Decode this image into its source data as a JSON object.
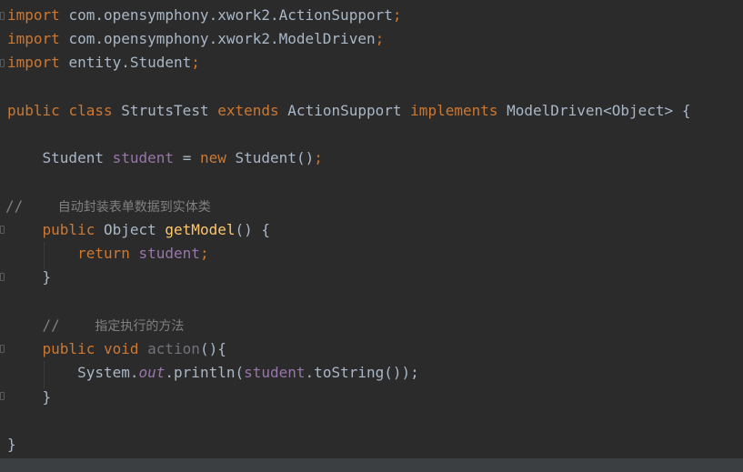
{
  "editor": {
    "line1": {
      "kw": "import",
      "path": "com.opensymphony.xwork2.ActionSupport",
      "semi": ";"
    },
    "line2": {
      "kw": "import",
      "path": "com.opensymphony.xwork2.ModelDriven",
      "semi": ";"
    },
    "line3": {
      "kw": "import",
      "path": "entity.Student",
      "semi": ";"
    },
    "classdecl": {
      "public": "public",
      "class": "class",
      "name": "StrutsTest",
      "extends": "extends",
      "parent": "ActionSupport",
      "implements": "implements",
      "iface": "ModelDriven<Object>",
      "brace": "{"
    },
    "field": {
      "type": "Student",
      "name": "student",
      "eq": "=",
      "new": "new",
      "ctor": "Student()",
      "semi": ";"
    },
    "comment1": {
      "slashes": "//",
      "text": "自动封装表单数据到实体类"
    },
    "getmodel": {
      "public": "public",
      "type": "Object",
      "name": "getModel",
      "rest": "() {"
    },
    "ret": {
      "kw": "return",
      "value": "student",
      "semi": ";"
    },
    "close1": "}",
    "comment2": {
      "slashes": "//",
      "text": "指定执行的方法"
    },
    "action": {
      "public": "public",
      "void": "void",
      "name": "action",
      "rest": "(){"
    },
    "println": {
      "sys": "System.",
      "out": "out",
      "call": ".println(",
      "arg": "student",
      "tostr": ".toString());"
    },
    "close2": "}",
    "close3": "}"
  },
  "colors": {
    "background": "#2b2b2b",
    "keyword": "#cc7832",
    "text": "#a9b7c6",
    "field": "#9876aa",
    "method": "#ffc66d",
    "comment": "#808080"
  }
}
